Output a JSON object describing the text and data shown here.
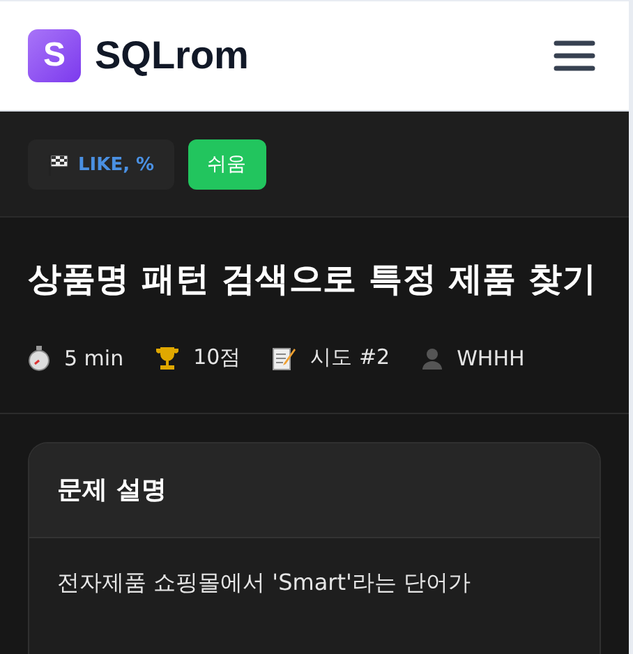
{
  "header": {
    "logo_letter": "S",
    "brand": "SQLrom"
  },
  "tags": [
    {
      "kind": "topic",
      "label": "LIKE, %"
    },
    {
      "kind": "difficulty",
      "label": "쉬움"
    }
  ],
  "problem": {
    "title": "상품명 패턴 검색으로 특정 제품 찾기",
    "meta": [
      "5 min",
      "10점",
      "시도 #2",
      "WHHH"
    ]
  },
  "card": {
    "heading": "문제 설명",
    "text": "전자제품 쇼핑몰에서 'Smart'라는 단어가"
  }
}
